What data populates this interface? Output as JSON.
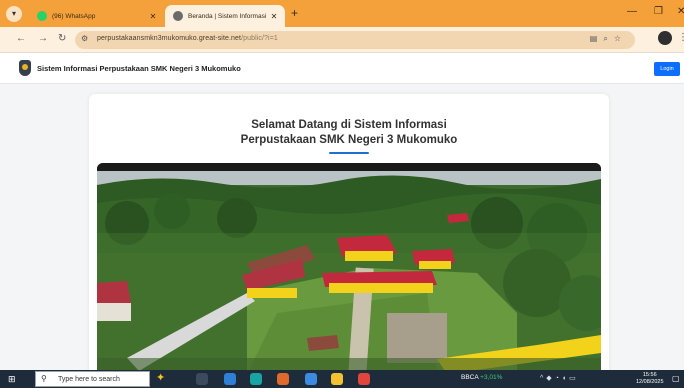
{
  "browser": {
    "tabs": [
      {
        "label": "(96) WhatsApp",
        "active": false,
        "icon": "whatsapp-icon",
        "color": "#25d366"
      },
      {
        "label": "Beranda | Sistem Informasi Perp",
        "active": true,
        "icon": "globe-icon"
      }
    ],
    "url_host": "perpustakaansmkn3mukomuko.great-site.net",
    "url_path": "/public/?i=1"
  },
  "header": {
    "site_title": "Sistem Informasi Perpustakaan SMK Negeri 3 Mukomuko",
    "login_label": "Login"
  },
  "main": {
    "welcome_line1": "Selamat Datang di Sistem Informasi",
    "welcome_line2": "Perpustakaan SMK Negeri 3 Mukomuko"
  },
  "taskbar": {
    "search_placeholder": "Type here to search",
    "stock_name": "BBCA",
    "stock_change": "+3,01%",
    "time": "15:56",
    "date": "12/08/2025"
  },
  "colors": {
    "tab_strip": "#f5a13b",
    "accent_blue": "#0d6efd",
    "taskbar": "#1d2b3a",
    "roof_red": "#c4283c",
    "wall_yellow": "#f2d21a"
  }
}
